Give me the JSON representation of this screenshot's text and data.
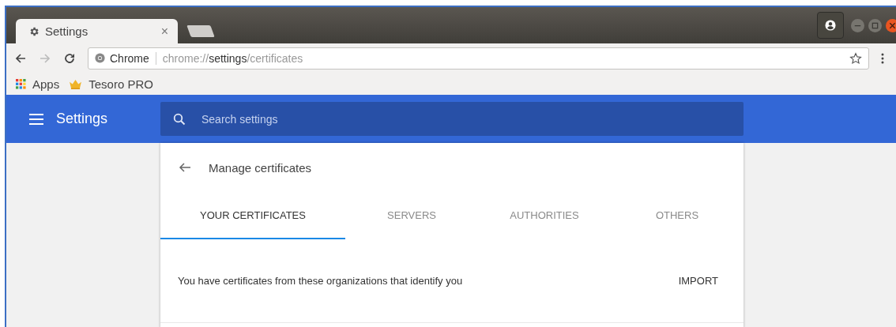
{
  "browser": {
    "tabs": [
      {
        "title": "Settings",
        "close": "×",
        "selected": true
      }
    ],
    "address_bar": {
      "origin": "Chrome",
      "url": "chrome://**settings**/certificates"
    },
    "bookmarks": [
      {
        "kind": "apps",
        "label": "Apps"
      },
      {
        "kind": "crown",
        "label": "Tesoro PRO"
      }
    ]
  },
  "header": {
    "title": "Settings",
    "search": {
      "placeholder": "Search settings"
    }
  },
  "page": {
    "title": "Manage certificates",
    "tabs": [
      {
        "label": "YOUR CERTIFICATES",
        "selected": true
      },
      {
        "label": "SERVERS",
        "selected": false
      },
      {
        "label": "AUTHORITIES",
        "selected": false
      },
      {
        "label": "OTHERS",
        "selected": false
      }
    ],
    "description": "You have certificates from these organizations that identify you",
    "action": "IMPORT"
  }
}
